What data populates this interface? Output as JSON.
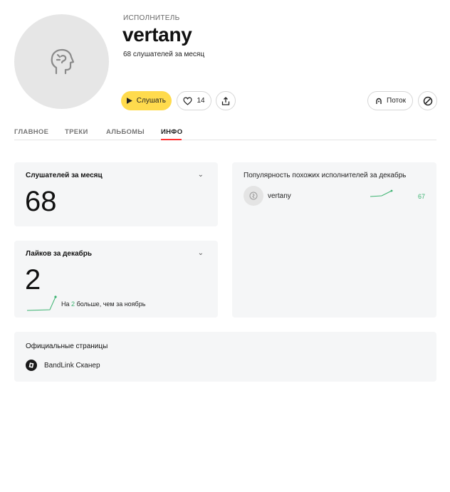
{
  "artist": {
    "kind_label": "ИСПОЛНИТЕЛЬ",
    "name": "vertany",
    "listeners_line": "68 слушателей за месяц"
  },
  "actions": {
    "play_label": "Слушать",
    "likes_count": "14",
    "flow_label": "Поток"
  },
  "tabs": [
    {
      "label": "ГЛАВНОЕ",
      "active": false
    },
    {
      "label": "ТРЕКИ",
      "active": false
    },
    {
      "label": "АЛЬБОМЫ",
      "active": false
    },
    {
      "label": "ИНФО",
      "active": true
    }
  ],
  "stats": {
    "listeners": {
      "title": "Слушателей за месяц",
      "value": "68"
    },
    "likes": {
      "title": "Лайков за декабрь",
      "value": "2",
      "change_prefix": "На",
      "change_value": "2",
      "change_suffix": "больше, чем за ноябрь"
    }
  },
  "similar": {
    "title": "Популярность похожих исполнителей за декабрь",
    "items": [
      {
        "name": "vertany",
        "value": "67"
      }
    ]
  },
  "official": {
    "title": "Официальные страницы",
    "links": [
      {
        "label": "BandLink Сканер"
      }
    ]
  },
  "colors": {
    "accent_yellow": "#ffdb4d",
    "tab_active_underline": "#ff3333",
    "positive_green": "#3cb371",
    "card_background": "#f5f6f7"
  },
  "icons": {
    "avatar": "person-profile-icon",
    "play": "play-icon",
    "like": "heart-icon",
    "share": "share-icon",
    "flow": "flow-icon",
    "block": "block-icon",
    "chevron": "chevron-down-icon",
    "bandlink": "bandlink-icon"
  }
}
